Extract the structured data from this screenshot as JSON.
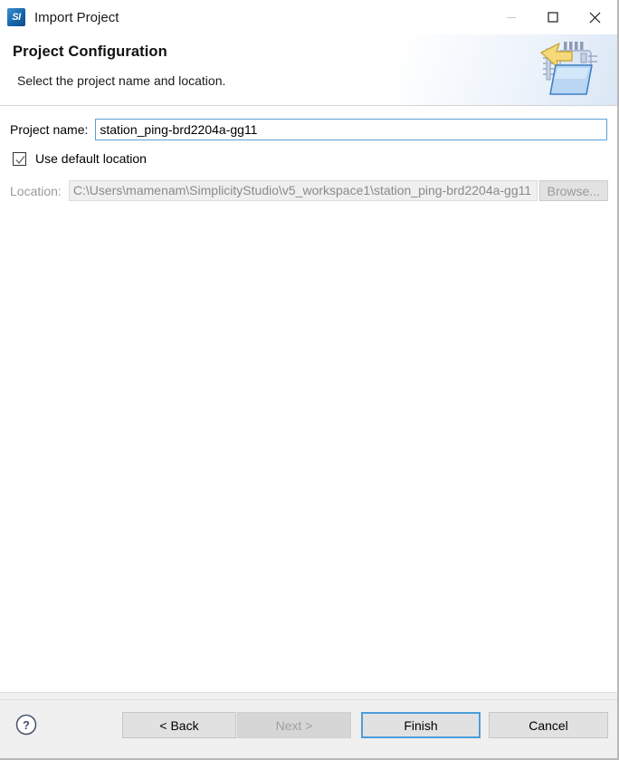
{
  "window": {
    "title": "Import Project",
    "app_icon": "simplicity-studio-icon",
    "icon_text": "SI",
    "controls": [
      {
        "name": "minimize",
        "glyph": "minimize-icon",
        "enabled": false
      },
      {
        "name": "maximize",
        "glyph": "maximize-icon",
        "enabled": true
      },
      {
        "name": "close",
        "glyph": "close-icon",
        "enabled": true
      }
    ]
  },
  "banner": {
    "title": "Project Configuration",
    "subtitle": "Select the project name and location.",
    "icon": "import-folder-icon"
  },
  "form": {
    "project_name_label": "Project name:",
    "project_name_value": "station_ping-brd2204a-gg11",
    "project_name_placeholder": "",
    "use_default_location_label": "Use default location",
    "use_default_location_checked": true,
    "location_label": "Location:",
    "location_value": "C:\\Users\\mamenam\\SimplicityStudio\\v5_workspace1\\station_ping-brd2204a-gg11",
    "browse_label": "Browse...",
    "browse_enabled": false
  },
  "footer": {
    "help_icon": "help-circle-icon",
    "buttons": [
      {
        "label": "< Back",
        "enabled": true,
        "default": false
      },
      {
        "label": "Next >",
        "enabled": false,
        "default": false
      },
      {
        "label": "Finish",
        "enabled": true,
        "default": true
      },
      {
        "label": "Cancel",
        "enabled": true,
        "default": false
      }
    ]
  },
  "colors": {
    "accent": "#4b9ddb",
    "focus_border": "#5b9ed4",
    "footer_bg": "#f0f0f0",
    "disabled_text": "#a0a0a0",
    "icon_blue": "#1565ab"
  }
}
